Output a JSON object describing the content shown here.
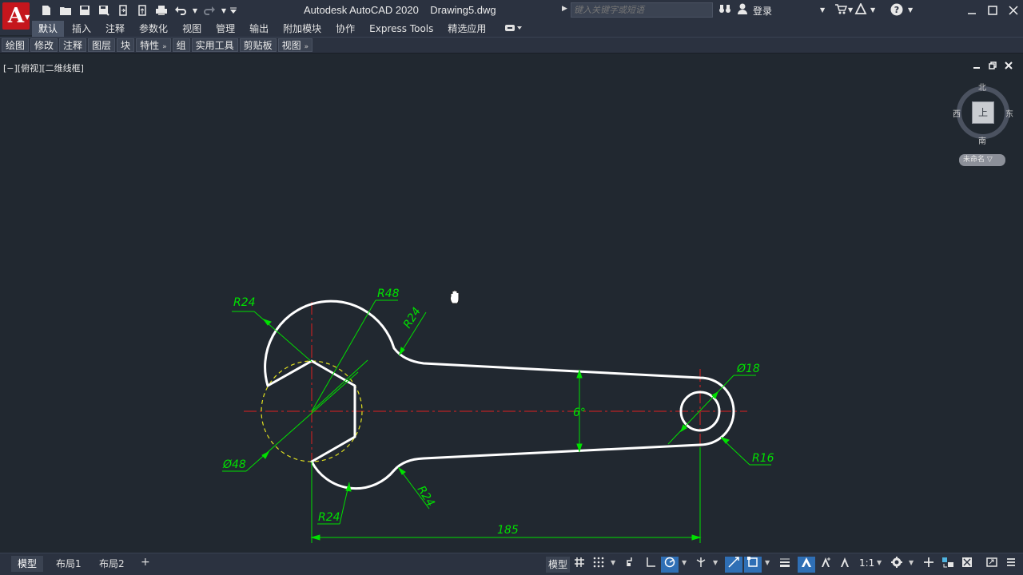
{
  "app": {
    "title": "Autodesk AutoCAD 2020    Drawing5.dwg",
    "logo_letter": "A",
    "search_placeholder": "键入关键字或短语",
    "login_label": "登录"
  },
  "ribbon": {
    "tabs": [
      "默认",
      "插入",
      "注释",
      "参数化",
      "视图",
      "管理",
      "输出",
      "附加模块",
      "协作",
      "Express Tools",
      "精选应用"
    ],
    "active_tab": "默认",
    "panels": [
      {
        "label": "绘图",
        "chevron": false
      },
      {
        "label": "修改",
        "chevron": false
      },
      {
        "label": "注释",
        "chevron": false
      },
      {
        "label": "图层",
        "chevron": false
      },
      {
        "label": "块",
        "chevron": false
      },
      {
        "label": "特性",
        "chevron": true
      },
      {
        "label": "组",
        "chevron": false
      },
      {
        "label": "实用工具",
        "chevron": false
      },
      {
        "label": "剪贴板",
        "chevron": false
      },
      {
        "label": "视图",
        "chevron": true
      }
    ]
  },
  "viewport": {
    "label": "[−][俯视][二维线框]",
    "viewcube": {
      "north": "北",
      "south": "南",
      "west": "西",
      "east": "东",
      "face": "上",
      "ucs": "未命名"
    }
  },
  "drawing": {
    "dimensions": {
      "r24_top_left": "R24",
      "r48": "R48",
      "r24_top_neck": "R24",
      "angle": "6°",
      "dia18": "Ø18",
      "r16": "R16",
      "dia48": "Ø48",
      "r24_bottom_left": "R24",
      "r24_bottom_neck": "R24",
      "length": "185"
    },
    "colors": {
      "outline": "#ffffff",
      "dimension": "#00e000",
      "centerline": "#e02020",
      "hidden_circle": "#e0e020"
    }
  },
  "statusbar": {
    "layout_tabs": [
      "模型",
      "布局1",
      "布局2"
    ],
    "active_layout": "模型",
    "model_label": "模型",
    "annotation_scale": "1:1"
  }
}
